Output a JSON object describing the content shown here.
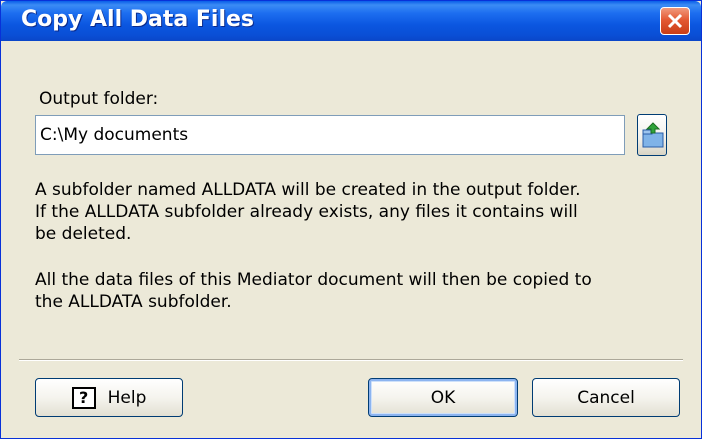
{
  "window": {
    "title": "Copy All Data Files"
  },
  "form": {
    "output_folder_label": "Output folder:",
    "output_folder_value": "C:\\My documents",
    "browse_icon": "folder-open-icon"
  },
  "description": {
    "lines": [
      "A subfolder named ALLDATA will be created in the output folder.",
      "If the ALLDATA subfolder already exists, any files it contains will",
      "be deleted.",
      "All the data files of this Mediator document will then be copied to",
      "the ALLDATA subfolder."
    ]
  },
  "buttons": {
    "help_label": "Help",
    "help_icon_glyph": "?",
    "ok_label": "OK",
    "cancel_label": "Cancel"
  },
  "colors": {
    "titlebar": "#0a5ee8",
    "close_button": "#e45a34",
    "dialog_background": "#ece9d8"
  }
}
